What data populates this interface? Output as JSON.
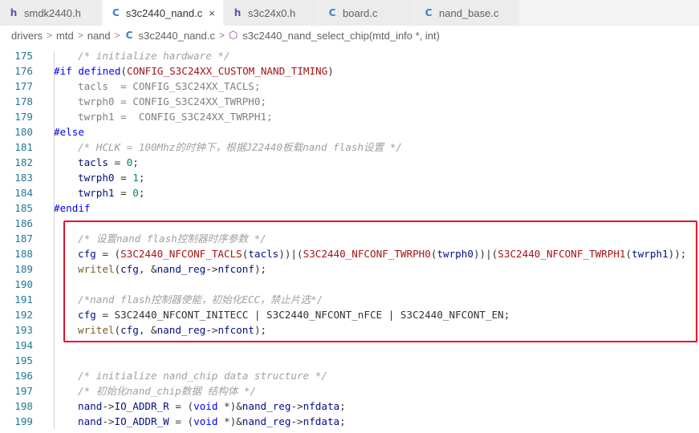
{
  "tabs": [
    {
      "icon": "h",
      "label": "smdk2440.h",
      "active": false
    },
    {
      "icon": "C",
      "label": "s3c2440_nand.c",
      "active": true,
      "close": "×"
    },
    {
      "icon": "h",
      "label": "s3c24x0.h",
      "active": false
    },
    {
      "icon": "C",
      "label": "board.c",
      "active": false
    },
    {
      "icon": "C",
      "label": "nand_base.c",
      "active": false
    }
  ],
  "breadcrumb": {
    "parts": [
      "drivers",
      "mtd",
      "nand"
    ],
    "file_icon": "C",
    "file": "s3c2440_nand.c",
    "symbol": "s3c2440_nand_select_chip(mtd_info *, int)"
  },
  "colors": {
    "highlight_border": "#e8112d",
    "line_number": "#237893",
    "keyword": "#0000ff",
    "comment": "#008000"
  },
  "lines": [
    {
      "n": "175",
      "code": "    /* initialize hardware */"
    },
    {
      "n": "176",
      "code": "#if defined(CONFIG_S3C24XX_CUSTOM_NAND_TIMING)"
    },
    {
      "n": "177",
      "code": "    tacls  = CONFIG_S3C24XX_TACLS;"
    },
    {
      "n": "178",
      "code": "    twrph0 = CONFIG_S3C24XX_TWRPH0;"
    },
    {
      "n": "179",
      "code": "    twrph1 =  CONFIG_S3C24XX_TWRPH1;"
    },
    {
      "n": "180",
      "code": "#else"
    },
    {
      "n": "181",
      "code": "    /* HCLK = 100Mhz的时钟下，根据JZ2440板载nand flash设置 */"
    },
    {
      "n": "182",
      "code": "    tacls = 0;"
    },
    {
      "n": "183",
      "code": "    twrph0 = 1;"
    },
    {
      "n": "184",
      "code": "    twrph1 = 0;"
    },
    {
      "n": "185",
      "code": "#endif"
    },
    {
      "n": "186",
      "code": ""
    },
    {
      "n": "187",
      "code": "    /* 设置nand flash控制器时序参数 */"
    },
    {
      "n": "188",
      "code": "    cfg = (S3C2440_NFCONF_TACLS(tacls))|(S3C2440_NFCONF_TWRPH0(twrph0))|(S3C2440_NFCONF_TWRPH1(twrph1));"
    },
    {
      "n": "189",
      "code": "    writel(cfg, &nand_reg->nfconf);"
    },
    {
      "n": "190",
      "code": ""
    },
    {
      "n": "191",
      "code": "    /*nand flash控制器使能，初始化ECC，禁止片选*/"
    },
    {
      "n": "192",
      "code": "    cfg = S3C2440_NFCONT_INITECC | S3C2440_NFCONT_nFCE | S3C2440_NFCONT_EN;"
    },
    {
      "n": "193",
      "code": "    writel(cfg, &nand_reg->nfcont);"
    },
    {
      "n": "194",
      "code": ""
    },
    {
      "n": "195",
      "code": ""
    },
    {
      "n": "196",
      "code": "    /* initialize nand_chip data structure */"
    },
    {
      "n": "197",
      "code": "    /* 初始化nand_chip数据 结构体 */"
    },
    {
      "n": "198",
      "code": "    nand->IO_ADDR_R = (void *)&nand_reg->nfdata;"
    },
    {
      "n": "199",
      "code": "    nand->IO_ADDR_W = (void *)&nand_reg->nfdata;"
    }
  ]
}
